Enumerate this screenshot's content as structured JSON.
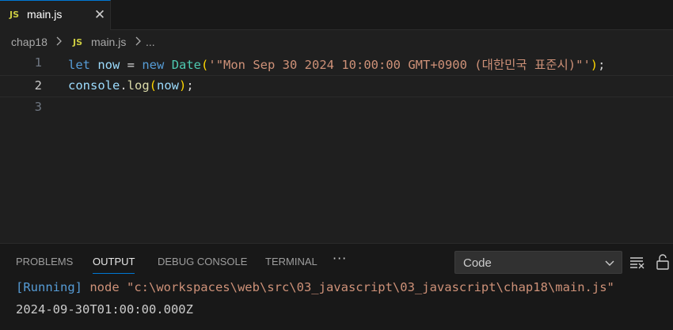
{
  "tab": {
    "icon": "JS",
    "label": "main.js",
    "close": "✕"
  },
  "breadcrumb": {
    "folder": "chap18",
    "icon": "JS",
    "file": "main.js",
    "more": "..."
  },
  "editor": {
    "line_numbers": [
      "1",
      "2",
      "3"
    ],
    "line1": {
      "kw_let": "let",
      "var_now": "now",
      "eq": " = ",
      "kw_new": "new",
      "cls_date": "Date",
      "open_paren": "(",
      "string": "'\"Mon Sep 30 2024 10:00:00 GMT+0900 (대한민국 표준시)\"'",
      "close_paren": ")",
      "semi": ";"
    },
    "line2": {
      "var_console": "console",
      "dot": ".",
      "fn_log": "log",
      "open_paren": "(",
      "var_now": "now",
      "close_paren": ")",
      "semi": ";"
    }
  },
  "panel": {
    "tabs": [
      "PROBLEMS",
      "OUTPUT",
      "DEBUG CONSOLE",
      "TERMINAL"
    ],
    "active_tab": "OUTPUT",
    "more": "···",
    "channel_select": "Code",
    "output": {
      "running_tag": "[Running]",
      "command": " node \"c:\\workspaces\\web\\src\\03_javascript\\03_javascript\\chap18\\main.js\"",
      "result": "2024-09-30T01:00:00.000Z"
    }
  },
  "colors": {
    "accent": "#0078d4",
    "keyword": "#569cd6",
    "string": "#ce9178",
    "class": "#4ec9b0",
    "function": "#dcdcaa",
    "variable": "#9cdcfe",
    "bracket": "#ffd700"
  },
  "icons": [
    "close-icon",
    "chevron-right-icon",
    "chevron-down-icon",
    "clear-output-icon",
    "lock-scroll-icon",
    "more-icon"
  ]
}
